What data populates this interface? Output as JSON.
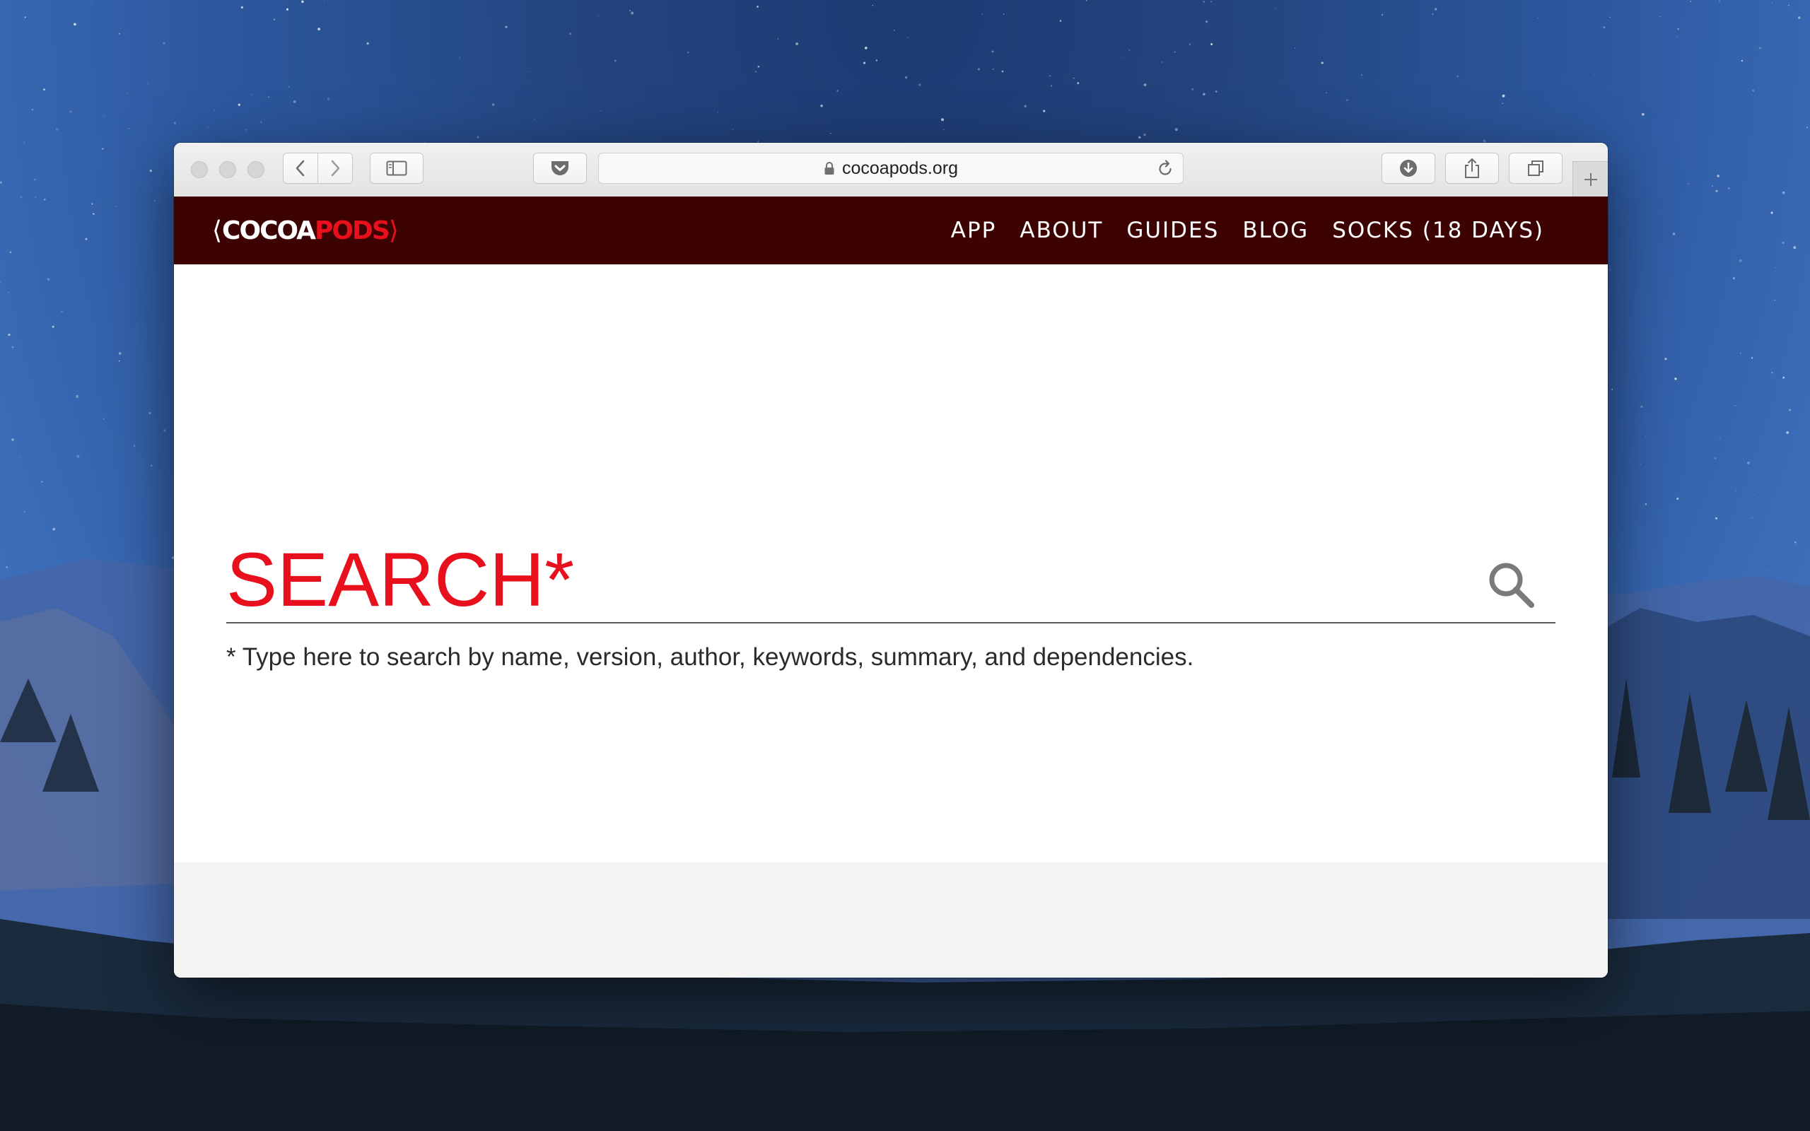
{
  "browser": {
    "url": "cocoapods.org",
    "buttons": {
      "back": "chevron-left-icon",
      "forward": "chevron-right-icon",
      "sidebar": "sidebar-icon",
      "pocket": "pocket-icon",
      "reload": "reload-icon",
      "downloads": "download-icon",
      "share": "share-icon",
      "tabs": "tabs-overview-icon",
      "new_tab": "plus-icon"
    }
  },
  "site": {
    "logo": {
      "left_bracket": "⟨",
      "cocoa": "COCOA",
      "pods": "PODS",
      "right_bracket": "⟩"
    },
    "nav": [
      {
        "label": "APP"
      },
      {
        "label": "ABOUT"
      },
      {
        "label": "GUIDES"
      },
      {
        "label": "BLOG"
      },
      {
        "label": "SOCKS (18 DAYS)"
      }
    ],
    "search": {
      "placeholder": "SEARCH*",
      "value": ""
    },
    "hint": "* Type here to search by name, version, author, keywords, summary, and dependencies."
  },
  "colors": {
    "brand_red": "#e8101c",
    "header_bg": "#3d0202",
    "footer_bg": "#f4f4f4"
  }
}
